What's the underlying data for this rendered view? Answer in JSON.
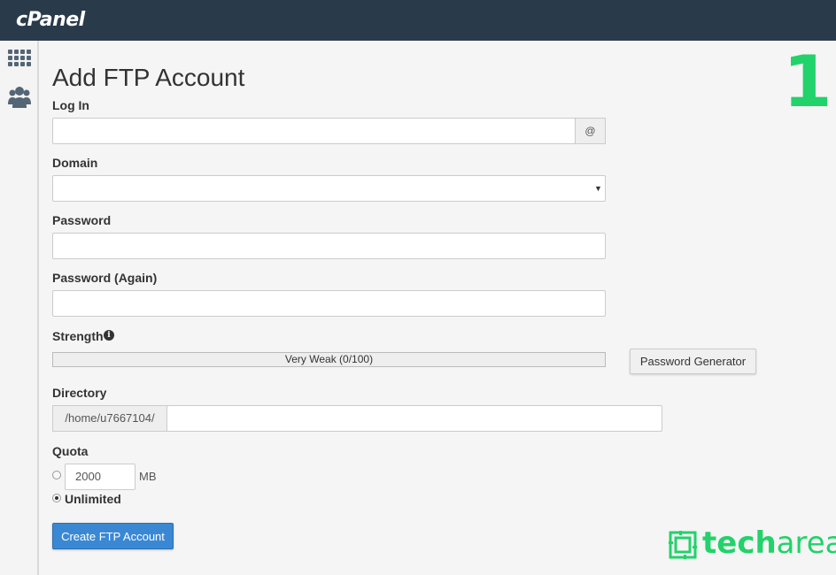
{
  "brand": {
    "logo": "cPanel"
  },
  "colors": {
    "topbar": "#293a4a",
    "primary": "#3a88d4",
    "watermark": "#22d26a"
  },
  "sidebar": {
    "icons": [
      "grid-icon",
      "users-icon"
    ]
  },
  "page": {
    "title": "Add FTP Account"
  },
  "form": {
    "login": {
      "label": "Log In",
      "value": "",
      "addon": "@"
    },
    "domain": {
      "label": "Domain",
      "selected": ""
    },
    "password": {
      "label": "Password",
      "value": ""
    },
    "password_again": {
      "label": "Password (Again)",
      "value": ""
    },
    "strength": {
      "label": "Strength",
      "meter_text": "Very Weak (0/100)",
      "score": 0
    },
    "generator_button": "Password Generator",
    "directory": {
      "label": "Directory",
      "prefix": "/home/u7667104/",
      "value": ""
    },
    "quota": {
      "label": "Quota",
      "value": "2000",
      "unit": "MB",
      "unlimited_label": "Unlimited",
      "selected": "unlimited"
    },
    "submit": "Create FTP Account"
  },
  "overlay": {
    "step_number": "1",
    "watermark_bold": "tech",
    "watermark_light": "area"
  }
}
